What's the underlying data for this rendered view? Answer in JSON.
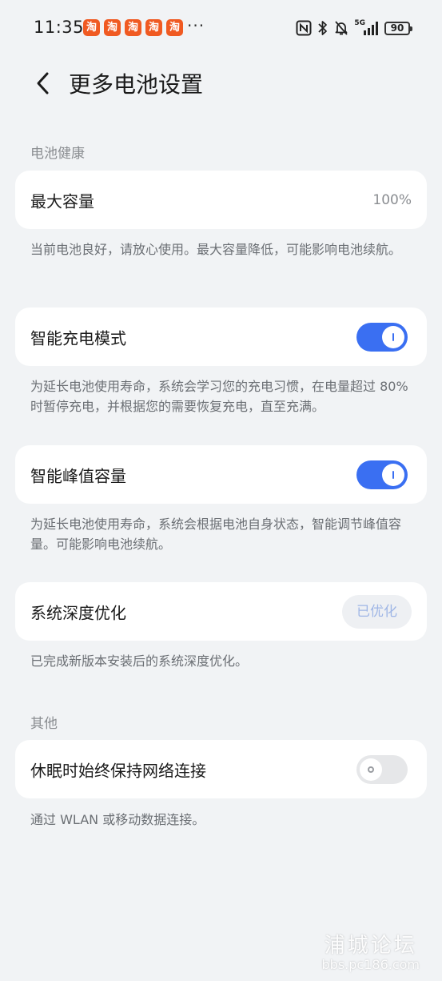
{
  "status_bar": {
    "time": "11:35",
    "app_badges": [
      "淘",
      "淘",
      "淘",
      "淘",
      "淘"
    ],
    "more": "···",
    "signal_label": "5G",
    "battery": "90",
    "icons": [
      "nfc-icon",
      "bluetooth-icon",
      "mute-bell-icon",
      "signal-icon",
      "battery-icon"
    ]
  },
  "header": {
    "back_icon": "chevron-left-icon",
    "title": "更多电池设置"
  },
  "battery_health": {
    "section_label": "电池健康",
    "max_capacity": {
      "label": "最大容量",
      "value": "100%"
    },
    "max_capacity_desc": "当前电池良好，请放心使用。最大容量降低，可能影响电池续航。",
    "smart_charge": {
      "label": "智能充电模式",
      "enabled": true
    },
    "smart_charge_desc": "为延长电池使用寿命，系统会学习您的充电习惯，在电量超过 80% 时暂停充电，并根据您的需要恢复充电，直至充满。",
    "peak_capacity": {
      "label": "智能峰值容量",
      "enabled": true
    },
    "peak_capacity_desc": "为延长电池使用寿命，系统会根据电池自身状态，智能调节峰值容量。可能影响电池续航。",
    "deep_optimize": {
      "label": "系统深度优化",
      "button": "已优化"
    },
    "deep_optimize_desc": "已完成新版本安装后的系统深度优化。"
  },
  "other": {
    "section_label": "其他",
    "keep_network": {
      "label": "休眠时始终保持网络连接",
      "enabled": false
    },
    "keep_network_desc": "通过 WLAN 或移动数据连接。"
  },
  "watermark": {
    "title": "浦城论坛",
    "url": "bbs.pc186.com"
  },
  "colors": {
    "background": "#f1f3f5",
    "card": "#ffffff",
    "accent": "#3a6ff2",
    "toggle_off": "#e6e7e9",
    "secondary_text": "#8a8d91",
    "badge": "#f05a22"
  }
}
